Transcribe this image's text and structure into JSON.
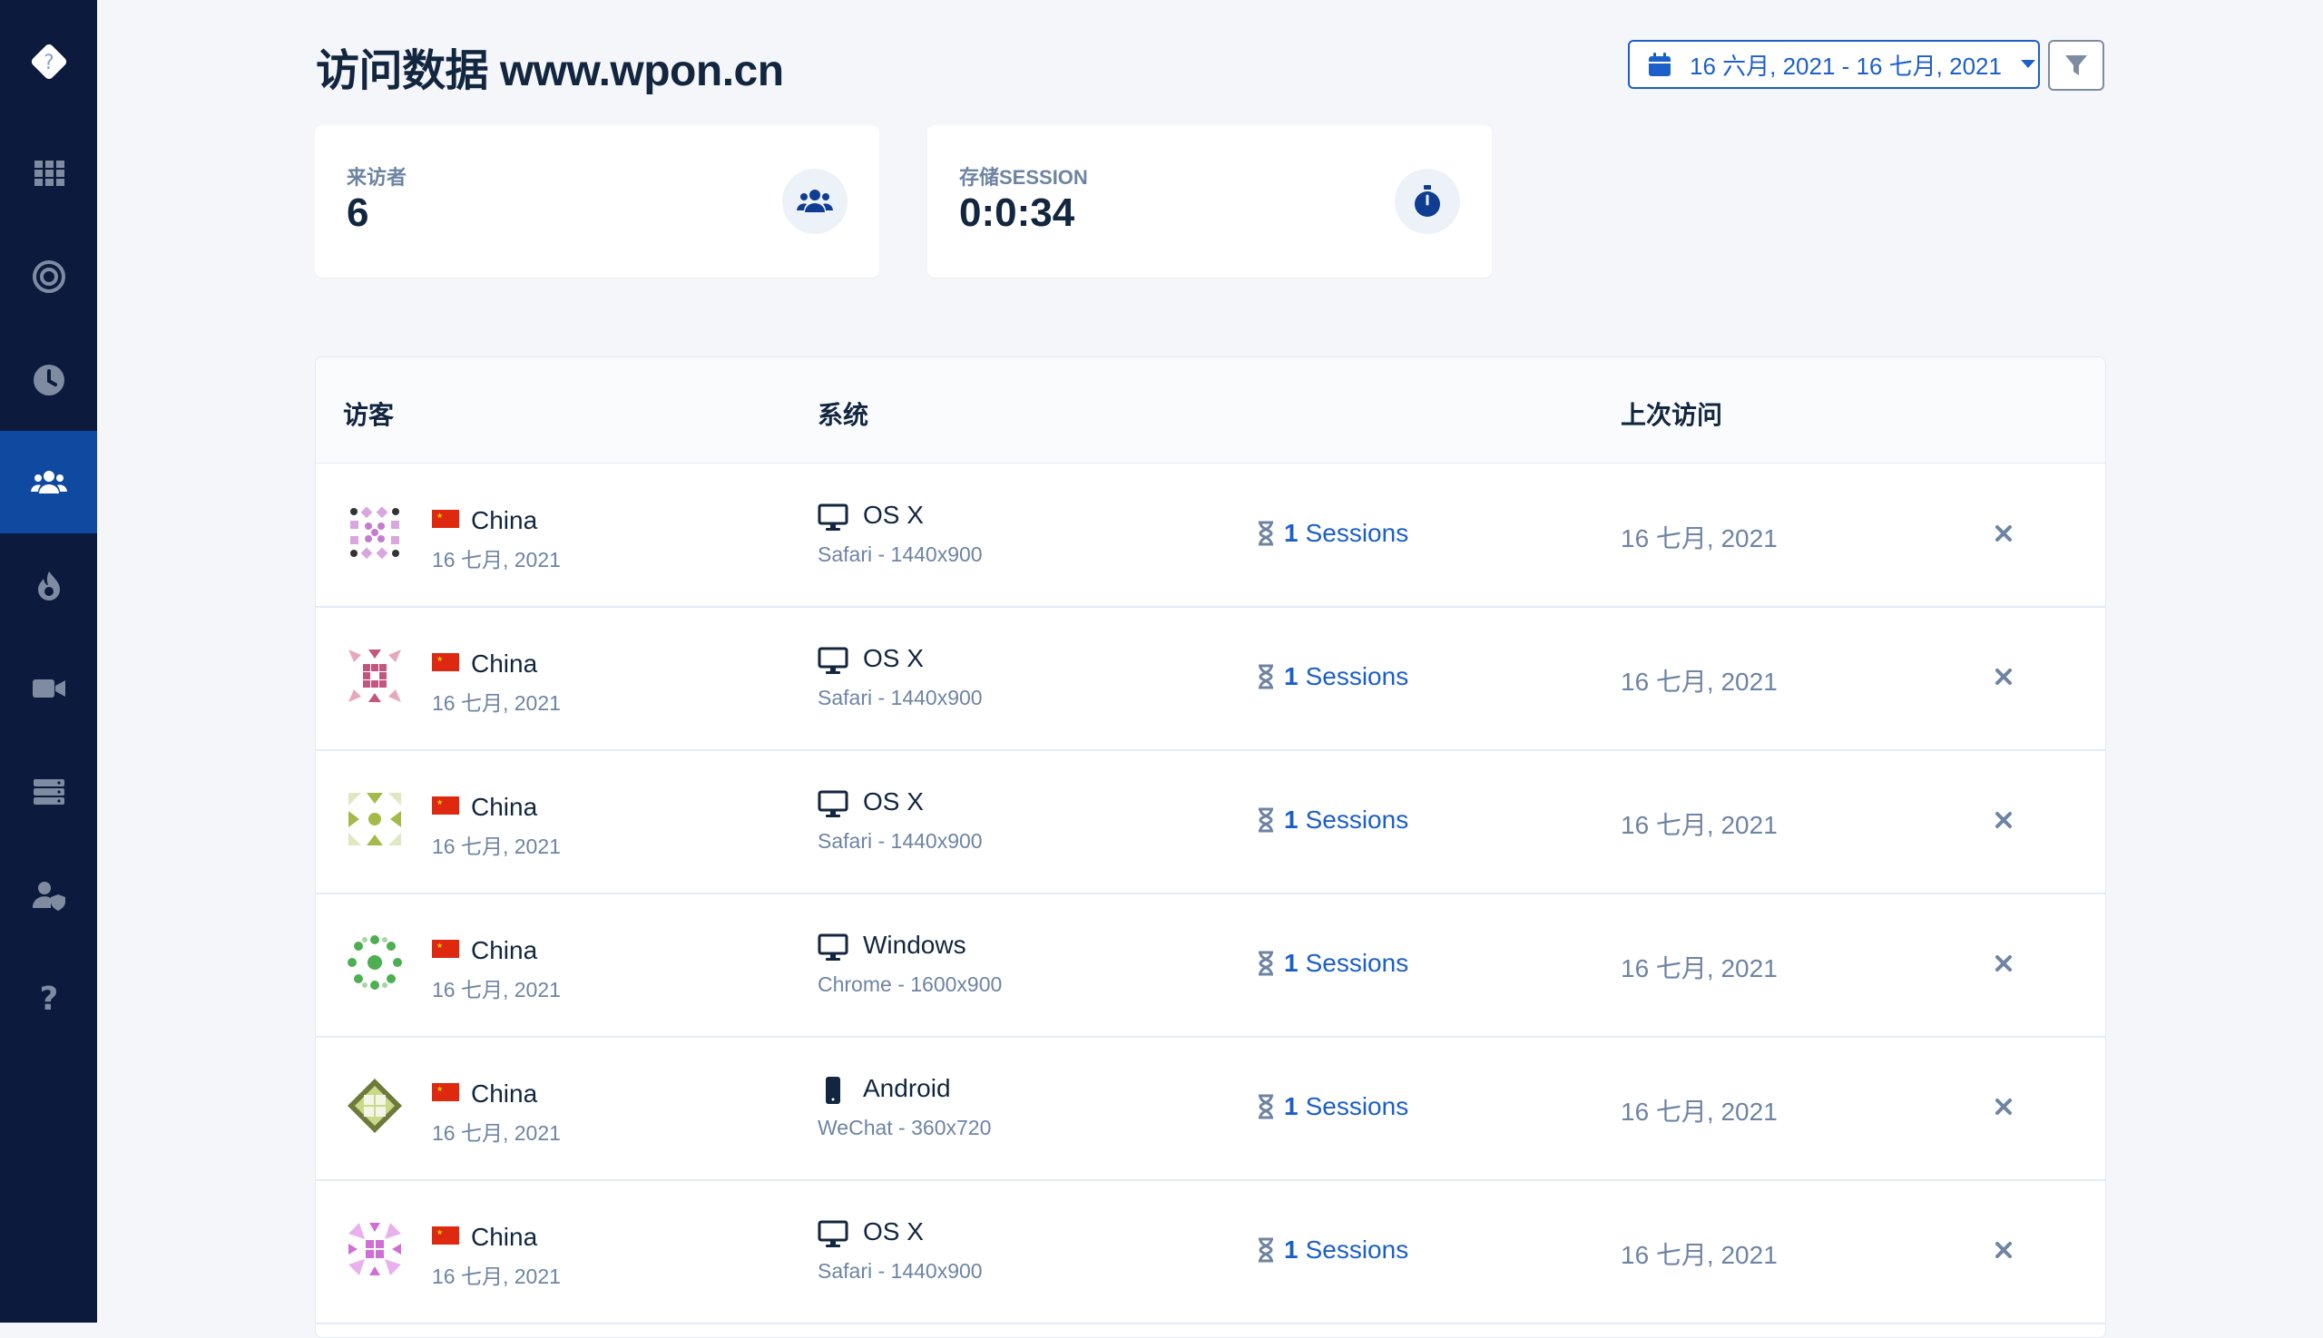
{
  "app": {
    "title": "访问数据 www.wpon.cn",
    "date_range": "16 六月, 2021 - 16 七月, 2021"
  },
  "sidebar": {
    "items": [
      {
        "icon": "grid-icon",
        "active": false
      },
      {
        "icon": "target-icon",
        "active": false
      },
      {
        "icon": "clock-icon",
        "active": false
      },
      {
        "icon": "users-icon",
        "active": true
      },
      {
        "icon": "fire-icon",
        "active": false
      },
      {
        "icon": "video-icon",
        "active": false
      },
      {
        "icon": "server-icon",
        "active": false
      },
      {
        "icon": "user-shield-icon",
        "active": false
      },
      {
        "icon": "question-icon",
        "active": false
      }
    ]
  },
  "stats": {
    "visitors": {
      "label": "来访者",
      "value": "6",
      "icon": "users-icon"
    },
    "session": {
      "label": "存储SESSION",
      "value": "0:0:34",
      "icon": "stopwatch-icon"
    }
  },
  "table": {
    "headers": {
      "visitor": "访客",
      "system": "系统",
      "last_visit": "上次访问"
    },
    "rows": [
      {
        "country": "China",
        "date": "16 七月, 2021",
        "os": "OS X",
        "device": "desktop",
        "browser": "Safari - 1440x900",
        "sessions_count": "1",
        "sessions_label": "Sessions",
        "last_visit": "16 七月, 2021"
      },
      {
        "country": "China",
        "date": "16 七月, 2021",
        "os": "OS X",
        "device": "desktop",
        "browser": "Safari - 1440x900",
        "sessions_count": "1",
        "sessions_label": "Sessions",
        "last_visit": "16 七月, 2021"
      },
      {
        "country": "China",
        "date": "16 七月, 2021",
        "os": "OS X",
        "device": "desktop",
        "browser": "Safari - 1440x900",
        "sessions_count": "1",
        "sessions_label": "Sessions",
        "last_visit": "16 七月, 2021"
      },
      {
        "country": "China",
        "date": "16 七月, 2021",
        "os": "Windows",
        "device": "desktop",
        "browser": "Chrome - 1600x900",
        "sessions_count": "1",
        "sessions_label": "Sessions",
        "last_visit": "16 七月, 2021"
      },
      {
        "country": "China",
        "date": "16 七月, 2021",
        "os": "Android",
        "device": "mobile",
        "browser": "WeChat - 360x720",
        "sessions_count": "1",
        "sessions_label": "Sessions",
        "last_visit": "16 七月, 2021"
      },
      {
        "country": "China",
        "date": "16 七月, 2021",
        "os": "OS X",
        "device": "desktop",
        "browser": "Safari - 1440x900",
        "sessions_count": "1",
        "sessions_label": "Sessions",
        "last_visit": "16 七月, 2021"
      }
    ]
  },
  "colors": {
    "sidebar_bg": "#0b1a3d",
    "sidebar_active": "#0f4aa0",
    "accent": "#1c5fc8",
    "muted_text": "#6e84a3"
  }
}
